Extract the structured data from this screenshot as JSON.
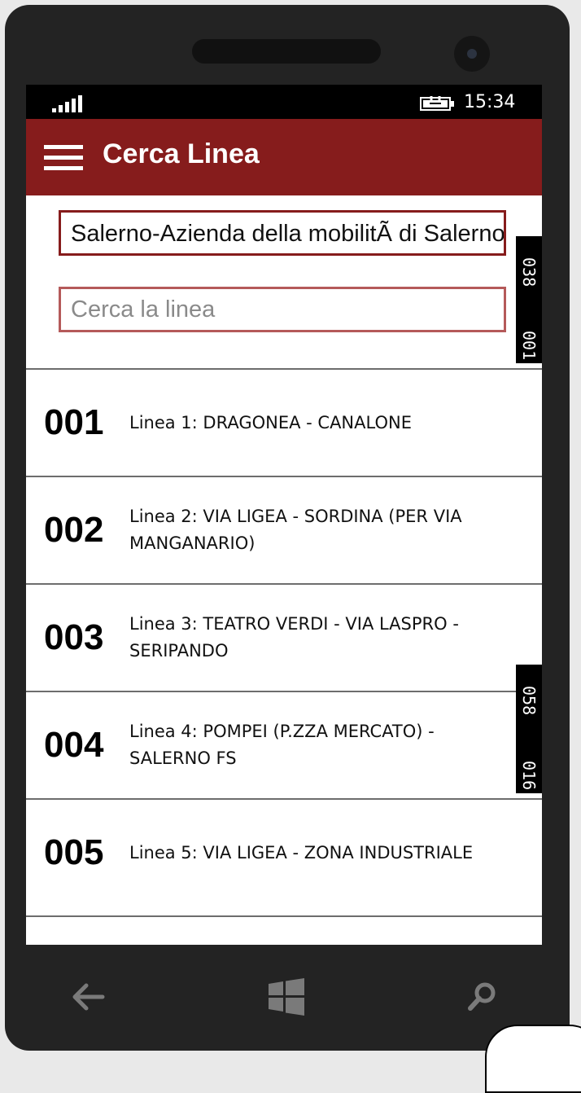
{
  "status_bar": {
    "time": "15:34",
    "signal_icon": "signal-bars-icon",
    "battery_icon": "battery-charging-icon"
  },
  "app_bar": {
    "menu_icon": "hamburger-menu-icon",
    "title": "Cerca Linea",
    "color": "#861c1c"
  },
  "agency_field": {
    "value": "Salerno-Azienda della mobilitÃ  di Salerno"
  },
  "search": {
    "placeholder": "Cerca la linea"
  },
  "overlay_tags": [
    {
      "first": "038",
      "second": "001"
    },
    {
      "first": "058",
      "second": "016"
    }
  ],
  "lines": [
    {
      "number": "001",
      "name": "Linea 1: DRAGONEA - CANALONE"
    },
    {
      "number": "002",
      "name": "Linea 2: VIA LIGEA - SORDINA (PER VIA MANGANARIO)"
    },
    {
      "number": "003",
      "name": "Linea 3: TEATRO VERDI - VIA LASPRO - SERIPANDO"
    },
    {
      "number": "004",
      "name": "Linea 4: POMPEI (P.ZZA MERCATO) - SALERNO FS"
    },
    {
      "number": "005",
      "name": "Linea 5: VIA LIGEA - ZONA INDUSTRIALE"
    }
  ],
  "nav": {
    "back_icon": "back-arrow-icon",
    "home_icon": "windows-logo-icon",
    "search_icon": "search-icon"
  }
}
